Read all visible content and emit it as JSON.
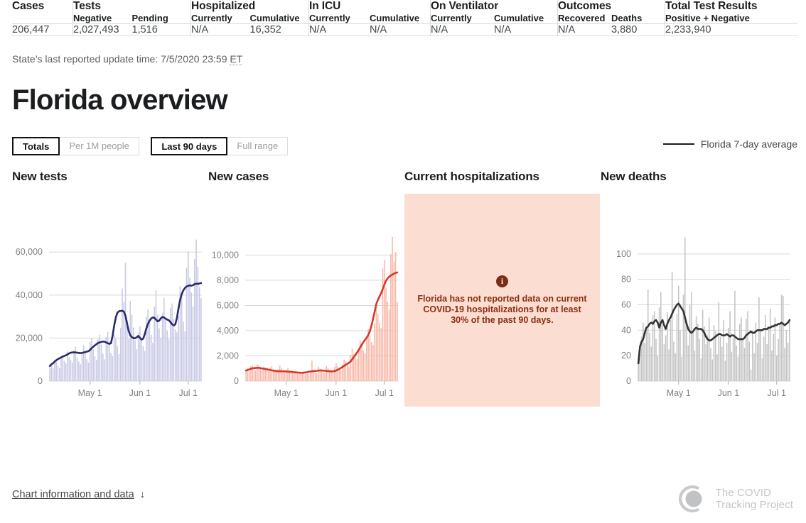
{
  "summary_table": {
    "groups": [
      {
        "name": "Cases",
        "subs": [
          ""
        ],
        "values": [
          "206,447"
        ]
      },
      {
        "name": "Tests",
        "subs": [
          "Negative",
          "Pending"
        ],
        "values": [
          "2,027,493",
          "1,516"
        ]
      },
      {
        "name": "Hospitalized",
        "subs": [
          "Currently",
          "Cumulative"
        ],
        "values": [
          "N/A",
          "16,352"
        ]
      },
      {
        "name": "In ICU",
        "subs": [
          "Currently",
          "Cumulative"
        ],
        "values": [
          "N/A",
          "N/A"
        ]
      },
      {
        "name": "On Ventilator",
        "subs": [
          "Currently",
          "Cumulative"
        ],
        "values": [
          "N/A",
          "N/A"
        ]
      },
      {
        "name": "Outcomes",
        "subs": [
          "Recovered",
          "Deaths"
        ],
        "values": [
          "N/A",
          "3,880"
        ]
      },
      {
        "name": "Total Test Results",
        "subs": [
          "Positive + Negative"
        ],
        "values": [
          "2,233,940"
        ]
      }
    ]
  },
  "update_line": {
    "prefix": "State’s last reported update time: 7/5/2020 23:59 ",
    "abbr": "ET"
  },
  "page_title": "Florida overview",
  "controls": {
    "group1": [
      {
        "label": "Totals",
        "active": true
      },
      {
        "label": "Per 1M people",
        "active": false
      }
    ],
    "group2": [
      {
        "label": "Last 90 days",
        "active": true
      },
      {
        "label": "Full range",
        "active": false
      }
    ]
  },
  "legend": {
    "label": "Florida 7-day average",
    "color": "#1b1d1f"
  },
  "notice": {
    "icon": "info-icon",
    "text": "Florida has not reported data on current COVID-19 hospitalizations for at least 30% of the past 90 days.",
    "bg_color": "#fbded1",
    "text_color": "#8a2d11"
  },
  "footer": {
    "link": "Chart information and data",
    "arrow": "↓",
    "brand_line1": "The COVID",
    "brand_line2": "Tracking Project"
  },
  "chart_data": [
    {
      "type": "bar",
      "title": "New tests",
      "xlabel": "",
      "ylabel": "",
      "ylim": [
        0,
        68000
      ],
      "yticks": [
        0,
        20000,
        40000,
        60000
      ],
      "ytick_labels": [
        "0",
        "20,000",
        "40,000",
        "60,000"
      ],
      "xticks": [
        "May 1",
        "Jun 1",
        "Jul 1"
      ],
      "xtick_index": [
        25,
        56,
        86
      ],
      "grid": true,
      "bar_color": "#c9c9e6",
      "line_color": "#2b2b6b",
      "series": [
        {
          "name": "Daily new tests",
          "type": "bar",
          "values": [
            6200,
            7400,
            5900,
            8800,
            9300,
            7100,
            6000,
            10500,
            11800,
            9400,
            8200,
            13900,
            11200,
            9900,
            8700,
            14200,
            15900,
            11000,
            9100,
            7800,
            12600,
            16800,
            13700,
            10200,
            8600,
            18200,
            20100,
            14800,
            11500,
            9800,
            19400,
            21500,
            17000,
            12800,
            10100,
            20500,
            22800,
            18600,
            13200,
            11700,
            21700,
            19800,
            16200,
            12500,
            24800,
            43100,
            36900,
            55100,
            28200,
            19600,
            37300,
            30800,
            24900,
            18900,
            14800,
            22600,
            25400,
            20100,
            16300,
            13900,
            29900,
            33500,
            27100,
            21500,
            17800,
            34600,
            42200,
            30900,
            24500,
            20200,
            31800,
            38700,
            29300,
            23600,
            19400,
            33900,
            36100,
            28800,
            24100,
            22700,
            30300,
            44200,
            38800,
            27500,
            23100,
            52600,
            60300,
            48100,
            41200,
            34600,
            56700,
            65800,
            53200,
            43800,
            38500
          ]
        },
        {
          "name": "7-day average",
          "type": "line",
          "values": [
            7000,
            7800,
            8300,
            9100,
            9700,
            10200,
            10600,
            11000,
            11400,
            11700,
            12000,
            12400,
            12900,
            13200,
            13300,
            13400,
            13300,
            13200,
            13100,
            13000,
            13100,
            13300,
            13500,
            13700,
            13900,
            14500,
            15300,
            16000,
            16600,
            17200,
            17700,
            18000,
            18200,
            18400,
            18300,
            18000,
            17600,
            17300,
            17600,
            21000,
            25800,
            29600,
            31800,
            32500,
            32600,
            32700,
            32300,
            30400,
            26800,
            23300,
            21300,
            20400,
            20000,
            19900,
            20400,
            21000,
            20100,
            19300,
            19700,
            21800,
            24500,
            26600,
            28100,
            29100,
            29600,
            29400,
            28600,
            27800,
            28100,
            29200,
            29800,
            29600,
            29000,
            28600,
            28300,
            27400,
            26400,
            25900,
            26400,
            29400,
            33900,
            37800,
            40500,
            42200,
            43300,
            44000,
            44300,
            44500,
            44400,
            44600,
            45100,
            45300,
            45200,
            45400,
            45600
          ]
        }
      ]
    },
    {
      "type": "bar",
      "title": "New cases",
      "xlabel": "",
      "ylabel": "",
      "ylim": [
        0,
        11600
      ],
      "yticks": [
        0,
        2000,
        4000,
        6000,
        8000,
        10000
      ],
      "ytick_labels": [
        "0",
        "2,000",
        "4,000",
        "6,000",
        "8,000",
        "10,000"
      ],
      "xticks": [
        "May 1",
        "Jun 1",
        "Jul 1"
      ],
      "xtick_index": [
        25,
        56,
        86
      ],
      "grid": true,
      "bar_color": "#f8b8a8",
      "line_color": "#d6392b",
      "series": [
        {
          "name": "Daily new cases",
          "type": "bar",
          "values": [
            880,
            1020,
            760,
            1180,
            1240,
            900,
            820,
            1330,
            1250,
            980,
            870,
            1150,
            1060,
            960,
            800,
            1070,
            1180,
            930,
            790,
            720,
            960,
            1230,
            1040,
            830,
            690,
            900,
            1040,
            870,
            730,
            640,
            740,
            820,
            700,
            610,
            560,
            700,
            780,
            640,
            590,
            540,
            760,
            1630,
            900,
            680,
            620,
            1140,
            1000,
            820,
            700,
            650,
            1200,
            1050,
            880,
            740,
            690,
            1110,
            1420,
            1170,
            960,
            840,
            1320,
            1700,
            1560,
            1290,
            1110,
            2080,
            2580,
            2150,
            1880,
            1740,
            2600,
            3200,
            2770,
            2440,
            2200,
            3500,
            4150,
            3590,
            3100,
            2880,
            4560,
            5900,
            5310,
            4620,
            4200,
            8940,
            9630,
            7420,
            6280,
            5680,
            10070,
            11450,
            9480,
            10250,
            6270
          ]
        },
        {
          "name": "7-day average",
          "type": "line",
          "values": [
            840,
            880,
            920,
            980,
            1010,
            1030,
            1040,
            1050,
            1050,
            1030,
            1000,
            980,
            960,
            940,
            910,
            880,
            850,
            830,
            810,
            790,
            780,
            780,
            780,
            780,
            770,
            760,
            750,
            740,
            730,
            720,
            700,
            690,
            680,
            670,
            660,
            660,
            670,
            690,
            710,
            740,
            760,
            780,
            790,
            800,
            810,
            830,
            840,
            840,
            830,
            820,
            800,
            790,
            780,
            770,
            770,
            790,
            830,
            890,
            960,
            1040,
            1120,
            1210,
            1290,
            1370,
            1450,
            1560,
            1720,
            1900,
            2080,
            2260,
            2450,
            2680,
            2900,
            3100,
            3280,
            3450,
            3650,
            3950,
            4400,
            4950,
            5520,
            6120,
            6450,
            6720,
            6980,
            7300,
            7650,
            7950,
            8150,
            8280,
            8380,
            8450,
            8520,
            8580,
            8620
          ]
        }
      ]
    },
    {
      "type": "notice",
      "title": "Current hospitalizations",
      "notice": "Florida has not reported data on current COVID-19 hospitalizations for at least 30% of the past 90 days."
    },
    {
      "type": "bar",
      "title": "New deaths",
      "xlabel": "",
      "ylabel": "",
      "ylim": [
        0,
        115
      ],
      "yticks": [
        0,
        20,
        40,
        60,
        80,
        100
      ],
      "ytick_labels": [
        "0",
        "20",
        "40",
        "60",
        "80",
        "100"
      ],
      "xticks": [
        "May 1",
        "Jun 1",
        "Jul 1"
      ],
      "xtick_index": [
        25,
        56,
        86
      ],
      "grid": true,
      "bar_color": "#c4c4c4",
      "line_color": "#343434",
      "series": [
        {
          "name": "Daily new deaths",
          "type": "bar",
          "values": [
            18,
            24,
            35,
            46,
            30,
            41,
            72,
            38,
            27,
            52,
            55,
            33,
            20,
            58,
            70,
            44,
            29,
            36,
            54,
            25,
            48,
            86,
            31,
            22,
            53,
            75,
            40,
            19,
            68,
            113,
            47,
            28,
            60,
            70,
            38,
            24,
            51,
            45,
            33,
            18,
            56,
            43,
            29,
            36,
            50,
            26,
            17,
            44,
            39,
            21,
            62,
            35,
            27,
            48,
            16,
            30,
            42,
            55,
            23,
            34,
            71,
            28,
            19,
            45,
            50,
            33,
            26,
            49,
            55,
            31,
            9,
            38,
            22,
            46,
            30,
            66,
            41,
            18,
            35,
            52,
            29,
            43,
            57,
            24,
            37,
            50,
            20,
            33,
            46,
            68,
            67,
            26,
            40,
            30,
            48
          ]
        },
        {
          "name": "7-day average",
          "type": "line",
          "values": [
            14,
            27,
            31,
            33,
            38,
            42,
            43,
            45,
            46,
            45,
            47,
            48,
            46,
            42,
            46,
            48,
            44,
            41,
            45,
            48,
            50,
            53,
            56,
            58,
            60,
            61,
            59,
            57,
            55,
            50,
            45,
            41,
            39,
            38,
            39,
            41,
            42,
            41,
            41,
            41,
            40,
            38,
            35,
            33,
            32,
            32,
            33,
            34,
            35,
            36,
            37,
            37,
            36,
            36,
            36,
            37,
            36,
            35,
            36,
            36,
            35,
            34,
            33,
            33,
            33,
            33,
            34,
            36,
            37,
            38,
            39,
            38,
            38,
            39,
            40,
            40,
            40,
            40,
            41,
            41,
            41,
            42,
            42,
            43,
            43,
            44,
            44,
            45,
            45,
            46,
            45,
            44,
            45,
            46,
            48
          ]
        }
      ]
    }
  ]
}
